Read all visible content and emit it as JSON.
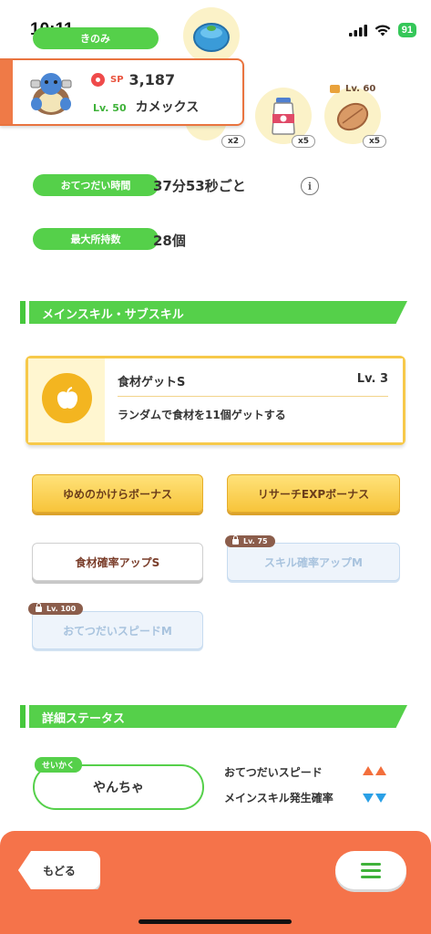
{
  "status_bar": {
    "time": "10:11",
    "battery": "91"
  },
  "top": {
    "kinomi_label": "きのみ",
    "ingredients": [
      {
        "name": "blue-berry-icon",
        "count": ""
      },
      {
        "name": "ingredient-hidden-icon",
        "count": "x2"
      },
      {
        "name": "milk-icon",
        "count": "x5"
      },
      {
        "name": "cacao-icon",
        "count": "x5",
        "lock_level": "Lv. 60"
      }
    ]
  },
  "pokemon": {
    "sp_label": "SP",
    "sp_value": "3,187",
    "level": "Lv. 50",
    "name": "カメックス"
  },
  "info": {
    "help_time_label": "おてつだい時間",
    "help_time_value": "37分53秒ごと",
    "info_icon_glyph": "i",
    "capacity_label": "最大所持数",
    "capacity_value": "28個"
  },
  "skills_section": {
    "title": "メインスキル・サブスキル",
    "main_skill": {
      "name": "食材ゲットS",
      "level": "Lv. 3",
      "description": "ランダムで食材を11個ゲットする"
    },
    "sub_skills": [
      {
        "label": "ゆめのかけらボーナス",
        "style": "gold",
        "locked": false
      },
      {
        "label": "リサーチEXPボーナス",
        "style": "gold",
        "locked": false
      },
      {
        "label": "食材確率アップS",
        "style": "white",
        "locked": false
      },
      {
        "label": "スキル確率アップM",
        "style": "locked",
        "lock_level": "Lv. 75"
      },
      {
        "label": "おてつだいスピードM",
        "style": "locked",
        "lock_level": "Lv. 100"
      }
    ]
  },
  "details_section": {
    "title": "詳細ステータス",
    "nature_tag": "せいかく",
    "nature_value": "やんちゃ",
    "stat_up": "おてつだいスピード",
    "stat_down": "メインスキル発生確率"
  },
  "bottom": {
    "back_label": "もどる"
  },
  "colors": {
    "accent_green": "#55d04a",
    "accent_orange": "#f5734a",
    "gold": "#f7c43a",
    "up_arrow": "#f36f3c",
    "down_arrow": "#2aa0e6"
  }
}
